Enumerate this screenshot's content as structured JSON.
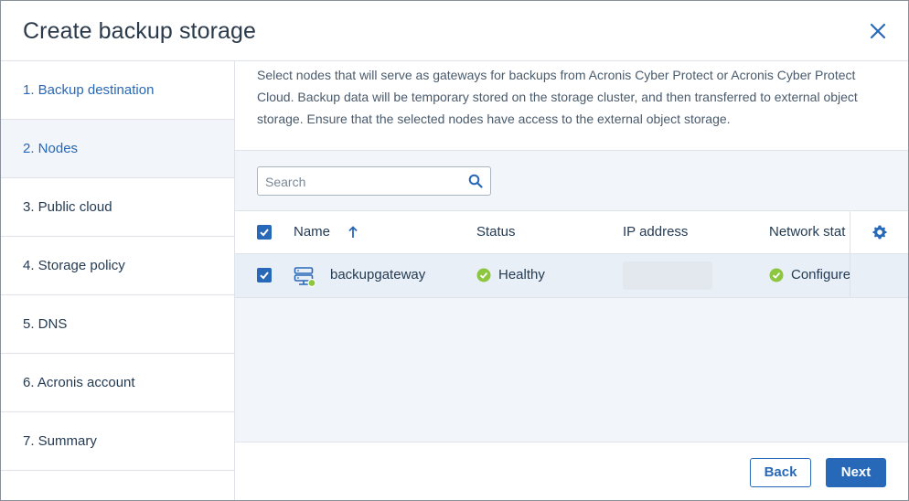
{
  "dialog": {
    "title": "Create backup storage",
    "close_icon": "close-icon"
  },
  "steps": [
    {
      "label": "1. Backup destination",
      "state": "done"
    },
    {
      "label": "2. Nodes",
      "state": "active"
    },
    {
      "label": "3. Public cloud",
      "state": "pending"
    },
    {
      "label": "4. Storage policy",
      "state": "pending"
    },
    {
      "label": "5. DNS",
      "state": "pending"
    },
    {
      "label": "6. Acronis account",
      "state": "pending"
    },
    {
      "label": "7. Summary",
      "state": "pending"
    }
  ],
  "description": "Select nodes that will serve as gateways for backups from Acronis Cyber Protect or Acronis Cyber Protect Cloud. Backup data will be temporary stored on the storage cluster, and then transferred to external object storage. Ensure that the selected nodes have access to the external object storage.",
  "search": {
    "placeholder": "Search",
    "value": ""
  },
  "table": {
    "columns": {
      "name": "Name",
      "status": "Status",
      "ip": "IP address",
      "network": "Network stat"
    },
    "sort": {
      "column": "name",
      "direction": "ascending",
      "icon": "arrow-up-icon"
    },
    "rows": [
      {
        "selected": true,
        "icon": "server-node-icon",
        "name": "backupgateway",
        "status": "Healthy",
        "ip": "",
        "network": "Configure"
      }
    ]
  },
  "footer": {
    "back_label": "Back",
    "next_label": "Next"
  },
  "colors": {
    "accent": "#2868b8",
    "healthy": "#8dc63f",
    "row_selected": "#e9eff7",
    "panel_bg": "#f2f5f9"
  }
}
